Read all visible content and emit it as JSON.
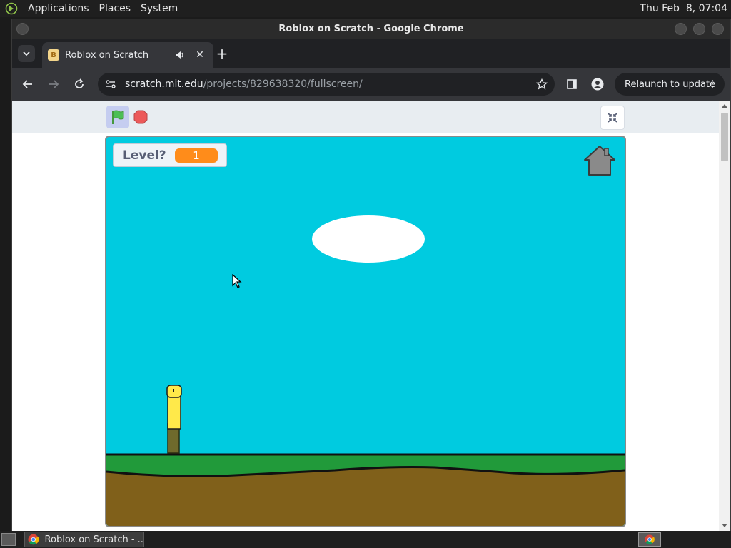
{
  "top_panel": {
    "menus": [
      "Applications",
      "Places",
      "System"
    ],
    "clock": "Thu Feb  8, 07:04"
  },
  "window": {
    "title": "Roblox on Scratch - Google Chrome"
  },
  "tab": {
    "title": "Roblox on Scratch",
    "favicon_letter": "B",
    "audio_icon": "speaker-icon",
    "close_label": "✕"
  },
  "new_tab_label": "+",
  "address_bar": {
    "host": "scratch.mit.edu",
    "path": "/projects/829638320/fullscreen/"
  },
  "relaunch": {
    "label": "Relaunch to update",
    "menu_glyph": "⋮"
  },
  "stage": {
    "monitor_label": "Level?",
    "monitor_value": "1"
  },
  "taskbar": {
    "item_label": "Roblox on Scratch - ..."
  },
  "colors": {
    "sky": "#00cbe0",
    "grass": "#219a3a",
    "dirt": "#80601a",
    "monitor_value": "#ff8c1a",
    "player_head": "#ffe94a",
    "player_legs": "#7a7a2e"
  }
}
